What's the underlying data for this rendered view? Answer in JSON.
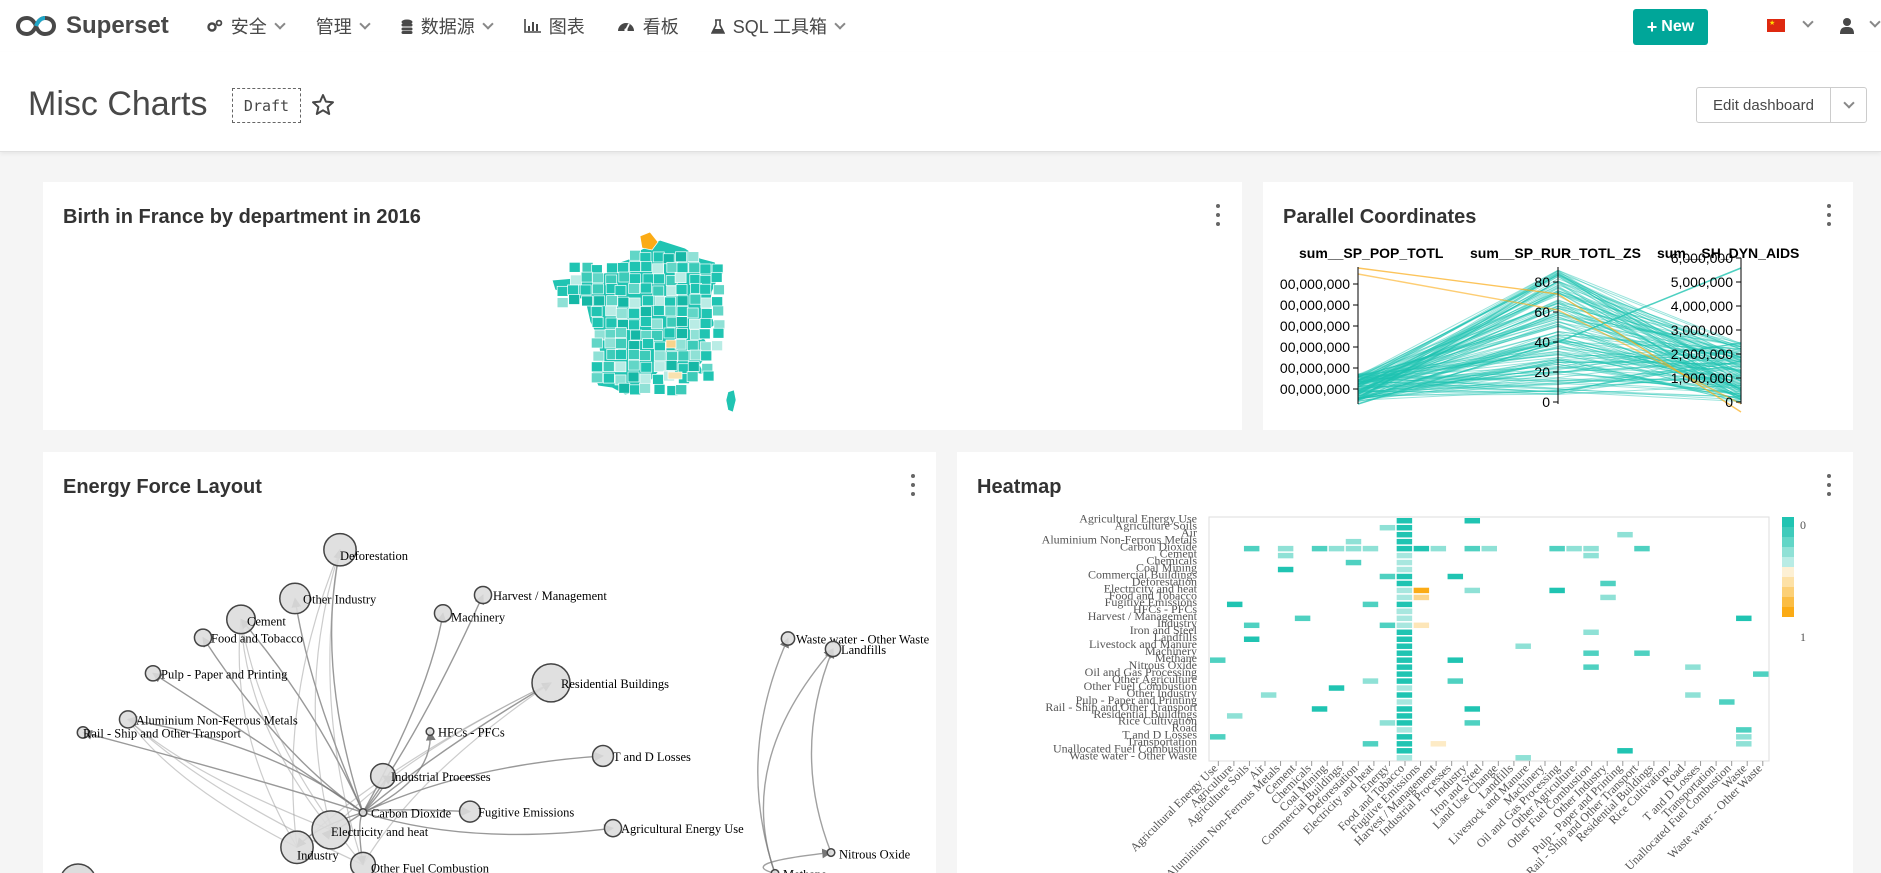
{
  "navbar": {
    "brand": "Superset",
    "menu": [
      {
        "label": "安全",
        "icon": "gears-icon"
      },
      {
        "label": "管理",
        "icon": ""
      },
      {
        "label": "数据源",
        "icon": "database-icon"
      },
      {
        "label": "图表",
        "icon": "bar-chart-icon"
      },
      {
        "label": "看板",
        "icon": "dashboard-icon"
      },
      {
        "label": "SQL 工具箱",
        "icon": "flask-icon"
      }
    ],
    "new_button": "New",
    "language_flag": "cn-flag-icon",
    "user_icon": "user-icon"
  },
  "header": {
    "title": "Misc Charts",
    "badge": "Draft",
    "edit_button": "Edit dashboard"
  },
  "colors": {
    "accent": "#00a699",
    "teal": "#20c4b2",
    "orange": "#fbab15"
  },
  "cards": {
    "france": {
      "title": "Birth in France by department in 2016"
    },
    "parallel": {
      "title": "Parallel Coordinates"
    },
    "energy": {
      "title": "Energy Force Layout"
    },
    "heatmap": {
      "title": "Heatmap"
    }
  },
  "chart_data": [
    {
      "type": "map",
      "title": "Birth in France by department in 2016",
      "region": "France",
      "color_scale": [
        "#d9f5f1",
        "#20c4b2",
        "#fbab15"
      ]
    },
    {
      "type": "parallel_coordinates",
      "title": "Parallel Coordinates",
      "axes": [
        {
          "name": "sum__SP_POP_TOTL",
          "ticks": [
            "00,000,000",
            "00,000,000",
            "00,000,000",
            "00,000,000",
            "00,000,000",
            "00,000,000"
          ]
        },
        {
          "name": "sum__SP_RUR_TOTL_ZS",
          "ticks": [
            "0",
            "20",
            "40",
            "60",
            "80"
          ]
        },
        {
          "name": "sum__SH_DYN_AIDS",
          "ticks": [
            "0",
            "1,000,000",
            "2,000,000",
            "3,000,000",
            "4,000,000",
            "5,000,000",
            "6,000,000"
          ]
        }
      ]
    },
    {
      "type": "force_directed_graph",
      "title": "Energy Force Layout",
      "nodes": [
        "Deforestation",
        "Other Industry",
        "Cement",
        "Harvest / Management",
        "Machinery",
        "Food and Tobacco",
        "Pulp - Paper and Printing",
        "Residential Buildings",
        "Aluminium Non-Ferrous Metals",
        "Rail - Ship and Other Transport",
        "HFCs - PFCs",
        "T and D Losses",
        "Industrial Processes",
        "Carbon Dioxide",
        "Electricity and heat",
        "Fugitive Emissions",
        "Agricultural Energy Use",
        "Industry",
        "Other Fuel Combustion",
        "Waste water - Other Waste",
        "Landfills",
        "Nitrous Oxide",
        "Methane"
      ]
    },
    {
      "type": "heatmap",
      "title": "Heatmap",
      "y_labels": [
        "Agricultural Energy Use",
        "Agriculture Soils",
        "Air",
        "Aluminium Non-Ferrous Metals",
        "Carbon Dioxide",
        "Cement",
        "Chemicals",
        "Coal Mining",
        "Commercial Buildings",
        "Deforestation",
        "Electricity and heat",
        "Food and Tobacco",
        "Fugitive Emissions",
        "HFCs - PFCs",
        "Harvest / Management",
        "Industry",
        "Iron and Steel",
        "Landfills",
        "Livestock and Manure",
        "Machinery",
        "Methane",
        "Nitrous Oxide",
        "Oil and Gas Processing",
        "Other Agriculture",
        "Other Fuel Combustion",
        "Other Industry",
        "Pulp - Paper and Printing",
        "Rail - Ship and Other Transport",
        "Residential Buildings",
        "Rice Cultivation",
        "Road",
        "T and D Losses",
        "Transportation",
        "Unallocated Fuel Combustion",
        "Waste water - Other Waste"
      ],
      "x_labels": [
        "Agricultural Energy Use",
        "Agriculture",
        "Agriculture Soils",
        "Air",
        "Aluminium Non-Ferrous Metals",
        "Cement",
        "Chemicals",
        "Coal Mining",
        "Commercial Buildings",
        "Deforestation",
        "Electricity and heat",
        "Energy",
        "Food and Tobacco",
        "Fugitive Emissions",
        "Harvest / Management",
        "Industrial Processes",
        "Industry",
        "Iron and Steel",
        "Land Use Change",
        "Landfills",
        "Livestock and Manure",
        "Machinery",
        "Oil and Gas Processing",
        "Other Agriculture",
        "Other Fuel Combustion",
        "Other Industry",
        "Pulp - Paper and Printing",
        "Rail - Ship and Other Transport",
        "Residential Buildings",
        "Rice Cultivation",
        "Road",
        "T and D Losses",
        "Transportation",
        "Unallocated Fuel Combustion",
        "Waste",
        "Waste water - Other Waste"
      ],
      "legend": {
        "min_label": "0",
        "max_label": "1"
      }
    }
  ]
}
